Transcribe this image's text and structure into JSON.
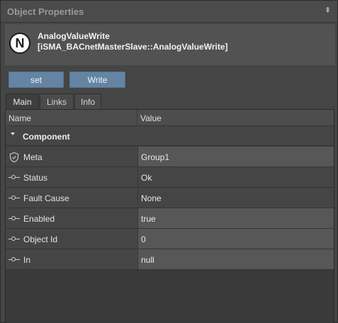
{
  "panel": {
    "title": "Object Properties",
    "pin_glyph": "⇞"
  },
  "object": {
    "logo_letter": "N",
    "name": "AnalogValueWrite",
    "type": "[iSMA_BACnetMasterSlave::AnalogValueWrite]"
  },
  "actions": {
    "set_label": "set",
    "write_label": "Write"
  },
  "tabs": {
    "main": "Main",
    "links": "Links",
    "info": "Info"
  },
  "grid": {
    "col_name": "Name",
    "col_value": "Value",
    "group_label": "Component",
    "rows": [
      {
        "name": "Meta",
        "value": "Group1",
        "icon": "shield-icon",
        "editable": true
      },
      {
        "name": "Status",
        "value": "Ok",
        "icon": "slot-icon",
        "editable": false
      },
      {
        "name": "Fault Cause",
        "value": "None",
        "icon": "slot-icon",
        "editable": false
      },
      {
        "name": "Enabled",
        "value": "true",
        "icon": "slot-icon",
        "editable": true
      },
      {
        "name": "Object Id",
        "value": "0",
        "icon": "slot-icon",
        "editable": true
      },
      {
        "name": "In",
        "value": "null",
        "icon": "slot-icon",
        "editable": true
      }
    ]
  },
  "colors": {
    "accent_button": "#6484a3",
    "editable_value_bg": "#575757"
  }
}
